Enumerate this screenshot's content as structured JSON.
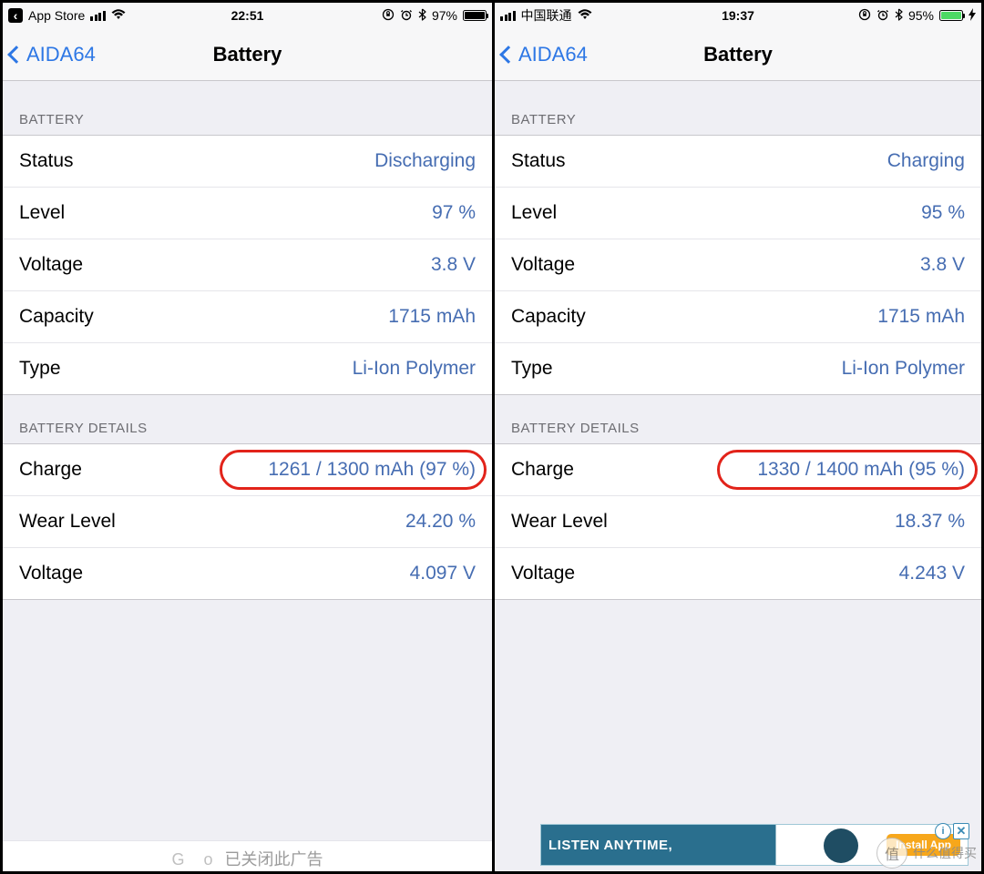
{
  "left": {
    "status": {
      "breadcrumb": "App Store",
      "time": "22:51",
      "battery_pct": "97%",
      "battery_fill_pct": 97,
      "charging": false
    },
    "nav": {
      "back": "AIDA64",
      "title": "Battery"
    },
    "section1_header": "BATTERY",
    "rows1": [
      {
        "label": "Status",
        "value": "Discharging"
      },
      {
        "label": "Level",
        "value": "97 %"
      },
      {
        "label": "Voltage",
        "value": "3.8 V"
      },
      {
        "label": "Capacity",
        "value": "1715 mAh"
      },
      {
        "label": "Type",
        "value": "Li-Ion Polymer"
      }
    ],
    "section2_header": "BATTERY DETAILS",
    "rows2": [
      {
        "label": "Charge",
        "value": "1261 / 1300 mAh (97 %)",
        "highlight": true
      },
      {
        "label": "Wear Level",
        "value": "24.20 %"
      },
      {
        "label": "Voltage",
        "value": "4.097 V"
      }
    ],
    "bottom_cutoff": "已关闭此广告"
  },
  "right": {
    "status": {
      "carrier": "中国联通",
      "time": "19:37",
      "battery_pct": "95%",
      "battery_fill_pct": 95,
      "charging": true
    },
    "nav": {
      "back": "AIDA64",
      "title": "Battery"
    },
    "section1_header": "BATTERY",
    "rows1": [
      {
        "label": "Status",
        "value": "Charging"
      },
      {
        "label": "Level",
        "value": "95 %"
      },
      {
        "label": "Voltage",
        "value": "3.8 V"
      },
      {
        "label": "Capacity",
        "value": "1715 mAh"
      },
      {
        "label": "Type",
        "value": "Li-Ion Polymer"
      }
    ],
    "section2_header": "BATTERY DETAILS",
    "rows2": [
      {
        "label": "Charge",
        "value": "1330 / 1400 mAh (95 %)",
        "highlight": true
      },
      {
        "label": "Wear Level",
        "value": "18.37 %"
      },
      {
        "label": "Voltage",
        "value": "4.243 V"
      }
    ],
    "ad": {
      "text": "LISTEN ANYTIME,",
      "cta": "Install App"
    }
  },
  "icons": {
    "lock": "⊕",
    "alarm": "⏰",
    "bluetooth": "⋮⋮",
    "wifi": "◉",
    "bolt": "⚡"
  },
  "watermark": {
    "logo": "值",
    "text": "什么值得买"
  }
}
